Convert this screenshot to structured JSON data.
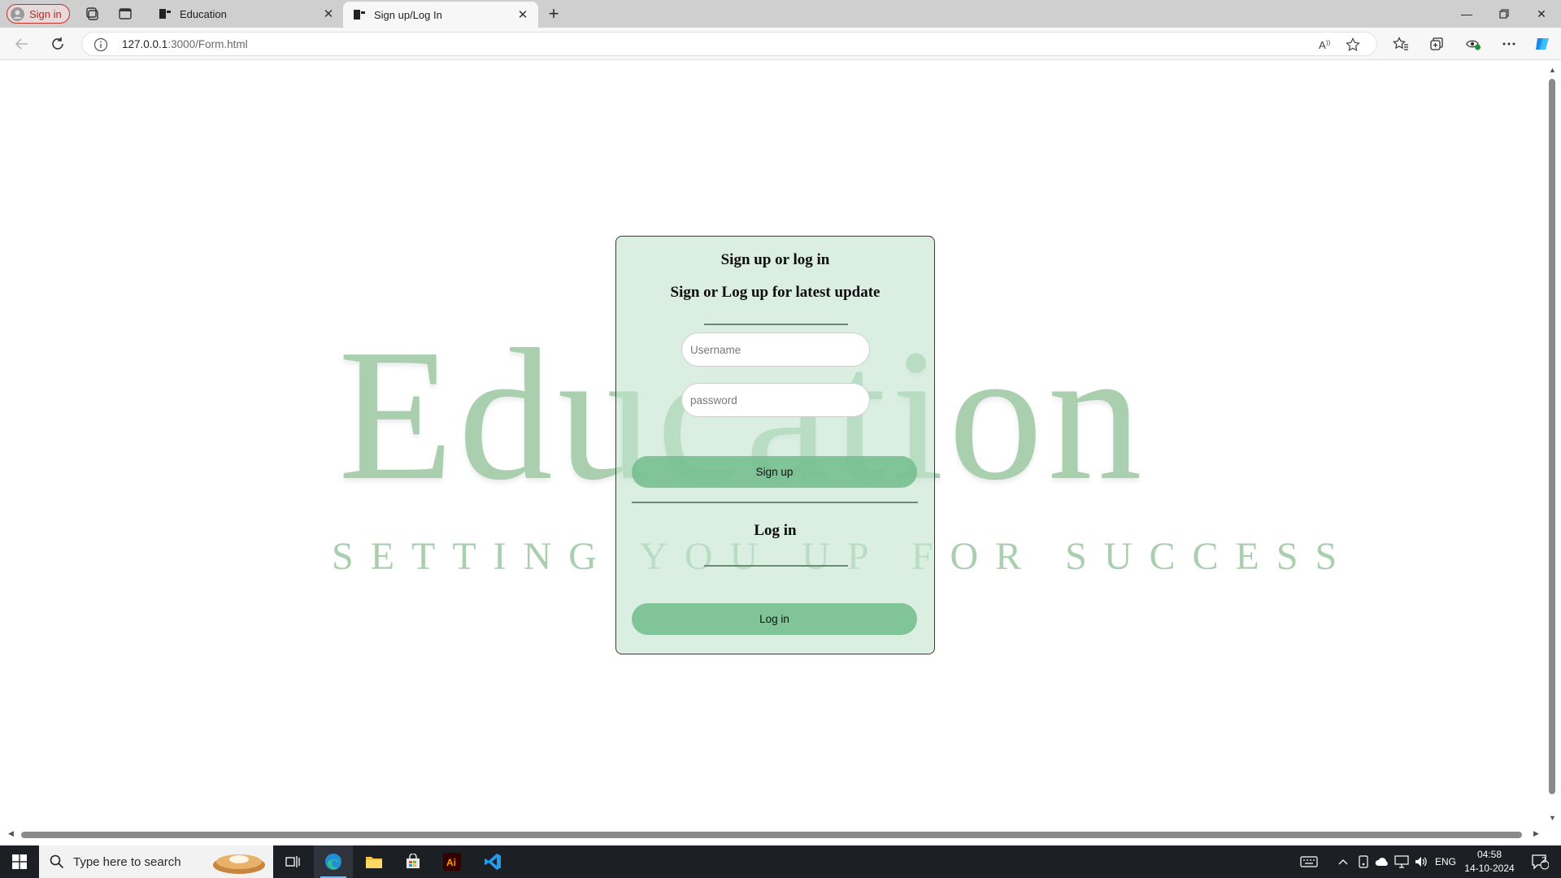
{
  "browser": {
    "profile_label": "Sign in",
    "tabs": [
      {
        "title": "Education",
        "active": false
      },
      {
        "title": "Sign up/Log In",
        "active": true
      }
    ],
    "address": {
      "host": "127.0.0.1",
      "rest": ":3000/Form.html"
    }
  },
  "page": {
    "watermark": {
      "word": "Education",
      "tagline": "SETTING YOU UP FOR SUCCESS"
    },
    "form": {
      "heading": "Sign up or log in",
      "subheading": "Sign or Log up for latest update",
      "username_placeholder": "Username",
      "password_placeholder": "password",
      "signup_label": "Sign up",
      "login_heading": "Log in",
      "login_label": "Log in"
    }
  },
  "taskbar": {
    "search_placeholder": "Type here to search",
    "language": "ENG",
    "time": "04:58",
    "date": "14-10-2024",
    "notification_count": "2"
  },
  "colors": {
    "card_bg": "#c4e5cf",
    "button_bg": "#76bf8f",
    "watermark": "#a9cfae",
    "profile_accent": "#c2312c"
  }
}
